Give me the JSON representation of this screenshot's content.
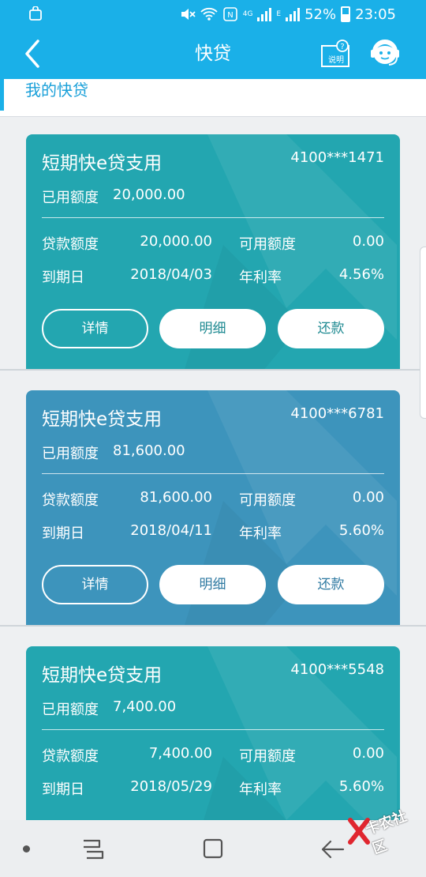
{
  "status_bar": {
    "network": "4G",
    "network_sub": "E",
    "battery": "52%",
    "time": "23:05",
    "icons": [
      "notification-bag-icon",
      "mute-icon",
      "wifi-icon",
      "nfc-icon",
      "signal-icon",
      "battery-icon"
    ]
  },
  "header": {
    "title": "快贷",
    "back_icon": "chevron-left-icon",
    "help_label": "说明",
    "service_icon": "customer-service-icon"
  },
  "section": {
    "label": "我的快贷"
  },
  "labels": {
    "used": "已用额度",
    "loan": "贷款额度",
    "available": "可用额度",
    "due": "到期日",
    "rate": "年利率",
    "detail_btn": "详情",
    "statement_btn": "明细",
    "repay_btn": "还款"
  },
  "loans": [
    {
      "product": "短期快e贷支用",
      "account": "4100***1471",
      "used_amount": "20,000.00",
      "loan_amount": "20,000.00",
      "available_amount": "0.00",
      "due_date": "2018/04/03",
      "annual_rate": "4.56%"
    },
    {
      "product": "短期快e贷支用",
      "account": "4100***6781",
      "used_amount": "81,600.00",
      "loan_amount": "81,600.00",
      "available_amount": "0.00",
      "due_date": "2018/04/11",
      "annual_rate": "5.60%"
    },
    {
      "product": "短期快e贷支用",
      "account": "4100***5548",
      "used_amount": "7,400.00",
      "loan_amount": "7,400.00",
      "available_amount": "0.00",
      "due_date": "2018/05/29",
      "annual_rate": "5.60%"
    }
  ],
  "nav": {
    "icons": [
      "dot-icon",
      "recent-apps-icon",
      "home-icon",
      "back-icon"
    ]
  },
  "watermark": {
    "text": "卡农社区"
  },
  "colors": {
    "primary": "#1ab0e8",
    "card_teal": "#23a6b0",
    "card_blue": "#3d94bc"
  }
}
